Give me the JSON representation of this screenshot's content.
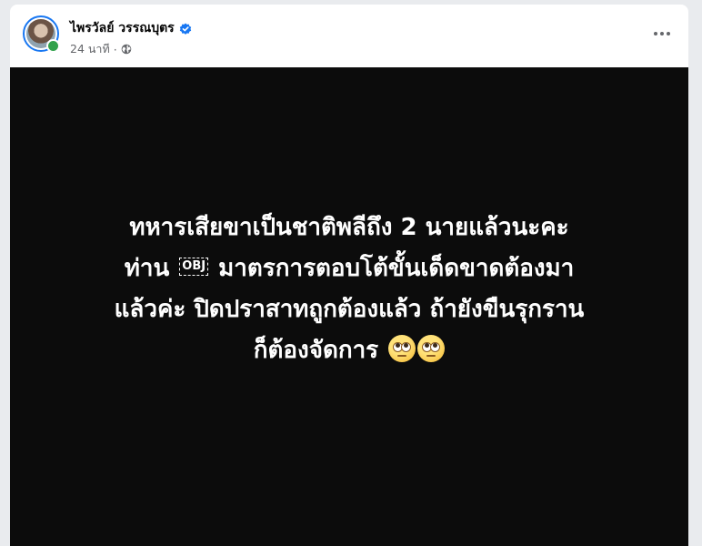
{
  "post": {
    "author_name": "ไพรวัลย์ วรรณบุตร",
    "timestamp": "24 นาที",
    "separator": "·",
    "privacy_icon": "globe-icon",
    "verified_icon": "verified-badge-icon",
    "more_icon": "more-options-icon"
  },
  "image_text": {
    "line1": "ทหารเสียขาเป็นชาติพลีถึง 2 นายแล้วนะคะ",
    "line2_pre": "ท่าน",
    "obj_placeholder": "OBJ",
    "line2_post": "มาตรการตอบโต้ขั้นเด็ดขาดต้องมา",
    "line3": "แล้วค่ะ ปิดปราสาทถูกต้องแล้ว ถ้ายังขืนรุกราน",
    "line4": "ก็ต้องจัดการ",
    "emoji_name": "face-with-rolling-eyes-emoji"
  },
  "colors": {
    "accent": "#1877f2",
    "online": "#31a24c",
    "image_background": "#0c0c0c",
    "meta_text": "#65676b"
  }
}
